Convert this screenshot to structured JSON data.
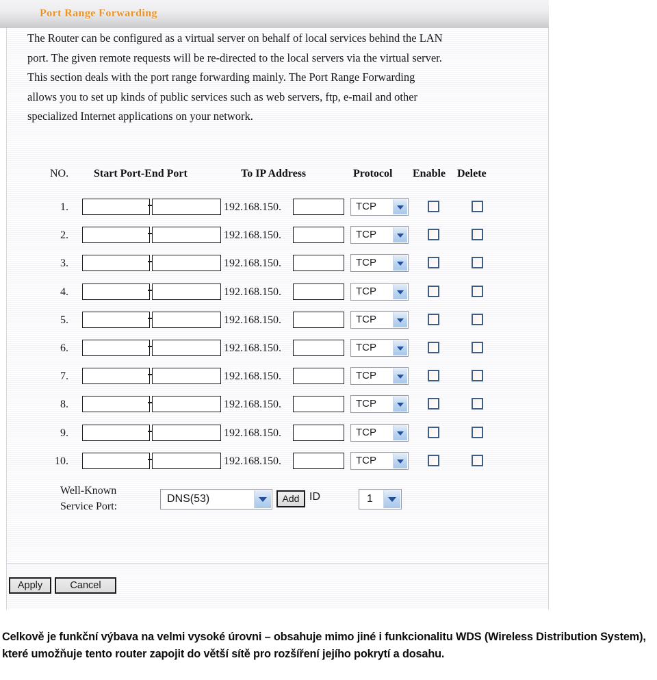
{
  "panel": {
    "title": "Port Range Forwarding",
    "title_color": "#f0921e",
    "description": [
      "The Router can be configured as a virtual server on behalf of local services behind the LAN",
      "port. The given remote requests will be re-directed to the local servers via the virtual server.",
      "This section deals with the port range forwarding mainly. The Port Range Forwarding",
      "allows you to set up kinds of public services such as web servers, ftp, e-mail and other",
      "specialized Internet applications on your network."
    ]
  },
  "table": {
    "headers": {
      "no": "NO.",
      "port_range": "Start Port-End Port",
      "ip": "To IP Address",
      "protocol": "Protocol",
      "enable": "Enable",
      "delete": "Delete"
    },
    "ip_prefix": "192.168.150.",
    "protocol_value": "TCP",
    "rows": [
      {
        "no": "1.",
        "start_port": "",
        "end_port": "",
        "ip_suffix": "",
        "protocol": "TCP",
        "enable": false,
        "delete": false
      },
      {
        "no": "2.",
        "start_port": "",
        "end_port": "",
        "ip_suffix": "",
        "protocol": "TCP",
        "enable": false,
        "delete": false
      },
      {
        "no": "3.",
        "start_port": "",
        "end_port": "",
        "ip_suffix": "",
        "protocol": "TCP",
        "enable": false,
        "delete": false
      },
      {
        "no": "4.",
        "start_port": "",
        "end_port": "",
        "ip_suffix": "",
        "protocol": "TCP",
        "enable": false,
        "delete": false
      },
      {
        "no": "5.",
        "start_port": "",
        "end_port": "",
        "ip_suffix": "",
        "protocol": "TCP",
        "enable": false,
        "delete": false
      },
      {
        "no": "6.",
        "start_port": "",
        "end_port": "",
        "ip_suffix": "",
        "protocol": "TCP",
        "enable": false,
        "delete": false
      },
      {
        "no": "7.",
        "start_port": "",
        "end_port": "",
        "ip_suffix": "",
        "protocol": "TCP",
        "enable": false,
        "delete": false
      },
      {
        "no": "8.",
        "start_port": "",
        "end_port": "",
        "ip_suffix": "",
        "protocol": "TCP",
        "enable": false,
        "delete": false
      },
      {
        "no": "9.",
        "start_port": "",
        "end_port": "",
        "ip_suffix": "",
        "protocol": "TCP",
        "enable": false,
        "delete": false
      },
      {
        "no": "10.",
        "start_port": "",
        "end_port": "",
        "ip_suffix": "",
        "protocol": "TCP",
        "enable": false,
        "delete": false
      }
    ]
  },
  "well_known": {
    "label_line1": "Well-Known",
    "label_line2": "Service Port:",
    "service_value": "DNS(53)",
    "add_label": "Add",
    "id_label": "ID",
    "id_value": "1"
  },
  "footer": {
    "apply_label": "Apply",
    "cancel_label": "Cancel"
  },
  "caption": {
    "lines": [
      "Celkově je funkční výbava na velmi vysoké úrovni – obsahuje mimo jiné i funkcionalitu WDS (Wireless",
      "Distribution System), které umožňuje tento router zapojit do větší sítě pro rozšíření jejího pokrytí a",
      "dosahu."
    ]
  }
}
